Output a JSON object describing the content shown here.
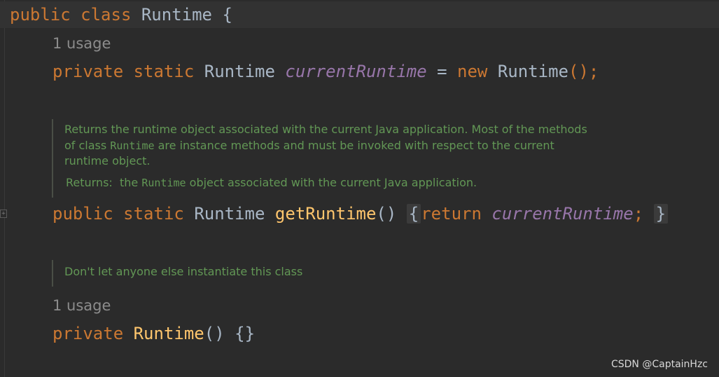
{
  "class_decl": {
    "kw_public": "public",
    "kw_class": "class",
    "name": "Runtime",
    "brace": "{"
  },
  "usage_1": "1 usage",
  "field_decl": {
    "kw_private": "private",
    "kw_static": "static",
    "type": "Runtime",
    "name": "currentRuntime",
    "assign": "=",
    "kw_new": "new",
    "ctor_call": "Runtime",
    "parens_semicolon": "();"
  },
  "doc_1": {
    "text_a": "Returns the runtime object associated with the current Java application. Most of the methods of class ",
    "code_a": "Runtime",
    "text_b": " are instance methods and must be invoked with respect to the current runtime object.",
    "returns_label": "Returns:",
    "returns_text_a": "the ",
    "returns_code": "Runtime",
    "returns_text_b": " object associated with the current Java application."
  },
  "method_decl": {
    "kw_public": "public",
    "kw_static": "static",
    "type": "Runtime",
    "name": "getRuntime",
    "parens": "()",
    "open_brace": "{",
    "kw_return": "return",
    "field": "currentRuntime",
    "semicolon": ";",
    "close_brace": "}"
  },
  "doc_2": {
    "text": "Don't let anyone else instantiate this class"
  },
  "usage_2": "1 usage",
  "ctor_decl": {
    "kw_private": "private",
    "name": "Runtime",
    "parens": "()",
    "body": "{}"
  },
  "watermark": "CSDN @CaptainHzc",
  "colors": {
    "background": "#2b2b2b",
    "keyword": "#cc7832",
    "plain": "#a9b7c6",
    "method": "#ffc66d",
    "field": "#9876aa",
    "doc_comment": "#629755",
    "usage_hint": "#8c8c8c"
  }
}
